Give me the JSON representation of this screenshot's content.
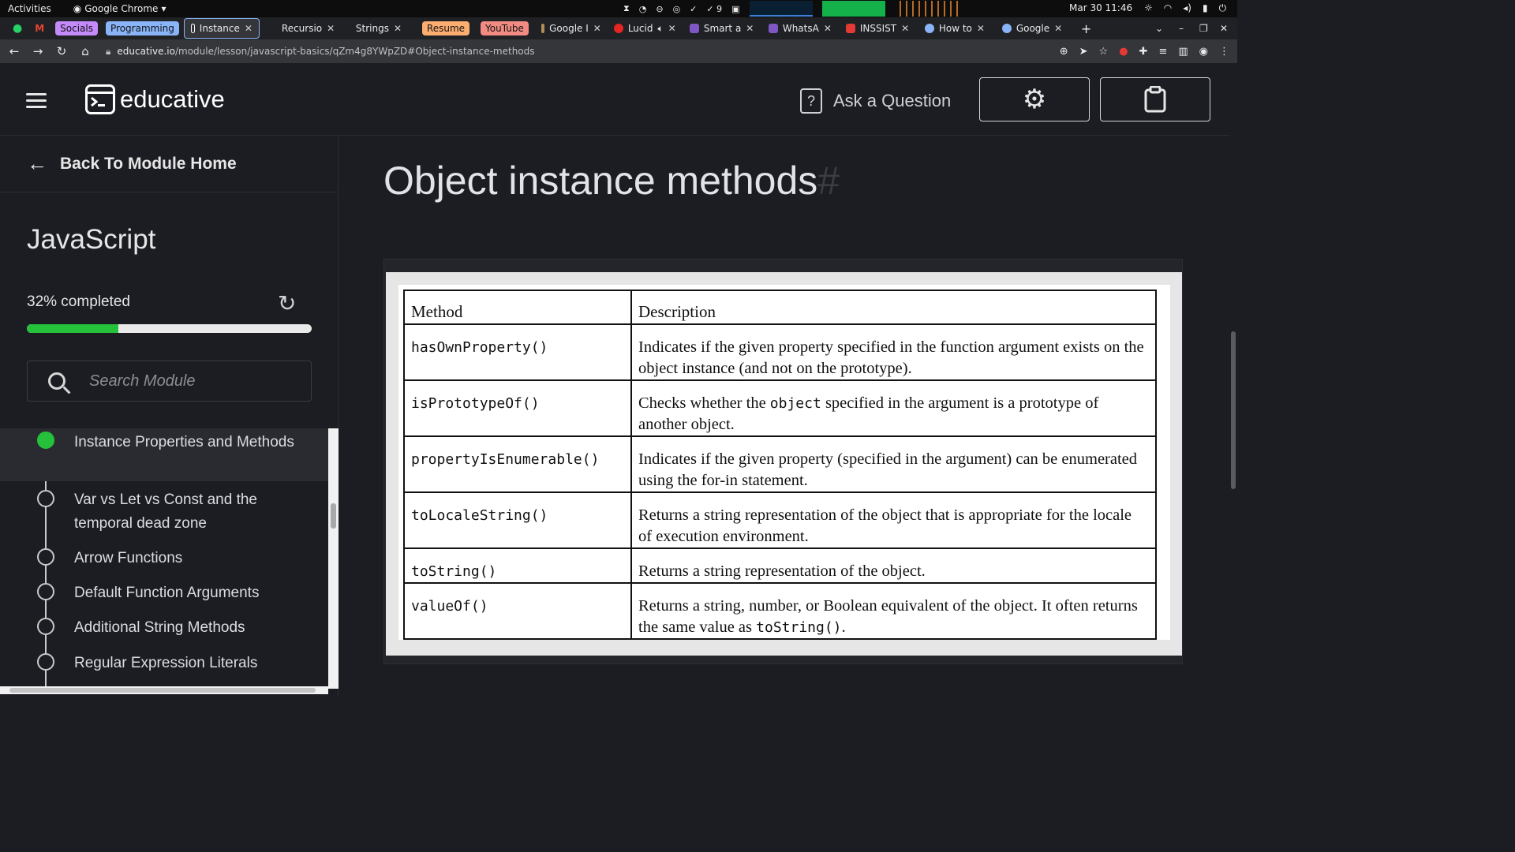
{
  "system": {
    "activities": "Activities",
    "app_name": "Google Chrome",
    "clock": "Mar 30  11:46",
    "tray_count": "9"
  },
  "tabs": [
    {
      "label": "Socials",
      "kind": "group",
      "color": "#c58af9"
    },
    {
      "label": "Programming",
      "kind": "group",
      "color": "#8ab4f8"
    },
    {
      "label": "Instance",
      "kind": "tab",
      "active": true
    },
    {
      "label": "Recursio",
      "kind": "tab"
    },
    {
      "label": "Strings",
      "kind": "tab"
    },
    {
      "label": "Resume",
      "kind": "group",
      "color": "#fcad70"
    },
    {
      "label": "YouTube",
      "kind": "group",
      "color": "#f28b82"
    },
    {
      "label": "Google I",
      "kind": "tab"
    },
    {
      "label": "Lucid",
      "kind": "tab"
    },
    {
      "label": "Smart a",
      "kind": "tab"
    },
    {
      "label": "WhatsA",
      "kind": "tab"
    },
    {
      "label": "INSSIST",
      "kind": "tab"
    },
    {
      "label": "How to",
      "kind": "tab"
    },
    {
      "label": "Google",
      "kind": "tab"
    }
  ],
  "address": {
    "domain": "educative.io",
    "path": "/module/lesson/javascript-basics/qZm4g8YWpZD#Object-instance-methods"
  },
  "header": {
    "logo_text": "educative",
    "ask_label": "Ask a Question"
  },
  "sidebar": {
    "back_label": "Back To Module Home",
    "course_title": "JavaScript",
    "progress_text": "32% completed",
    "progress_value": 0.32,
    "search_placeholder": "Search Module",
    "items": [
      {
        "label": "Instance Properties and Methods",
        "active": true
      },
      {
        "label": "Var vs Let vs Const and the temporal dead zone"
      },
      {
        "label": "Arrow Functions"
      },
      {
        "label": "Default Function Arguments"
      },
      {
        "label": "Additional String Methods"
      },
      {
        "label": "Regular Expression Literals"
      }
    ]
  },
  "main": {
    "title": "Object instance methods",
    "title_anchor": "#",
    "table": {
      "headers": [
        "Method",
        "Description"
      ],
      "rows": [
        {
          "method": "hasOwnProperty()",
          "description": "Indicates if the given property specified in the function argument exists on the object instance (and not on the prototype)."
        },
        {
          "method": "isPrototypeOf()",
          "description_pre": "Checks whether the ",
          "description_code": "object",
          "description_post": " specified in the argument is a prototype of another object."
        },
        {
          "method": "propertyIsEnumerable()",
          "description": "Indicates if the given property (specified in the argument) can be enumerated using the for-in statement."
        },
        {
          "method": "toLocaleString()",
          "description": "Returns a string representation of the object that is appropriate for the locale of execution environment."
        },
        {
          "method": "toString()",
          "description": "Returns a string representation of the object."
        },
        {
          "method": "valueOf()",
          "description_pre": "Returns a string, number, or Boolean equivalent of the object. It often returns the same value as ",
          "description_code": "toString()",
          "description_post": "."
        }
      ]
    }
  },
  "colors": {
    "accent_green": "#25c13b",
    "background": "#1c1d23"
  }
}
